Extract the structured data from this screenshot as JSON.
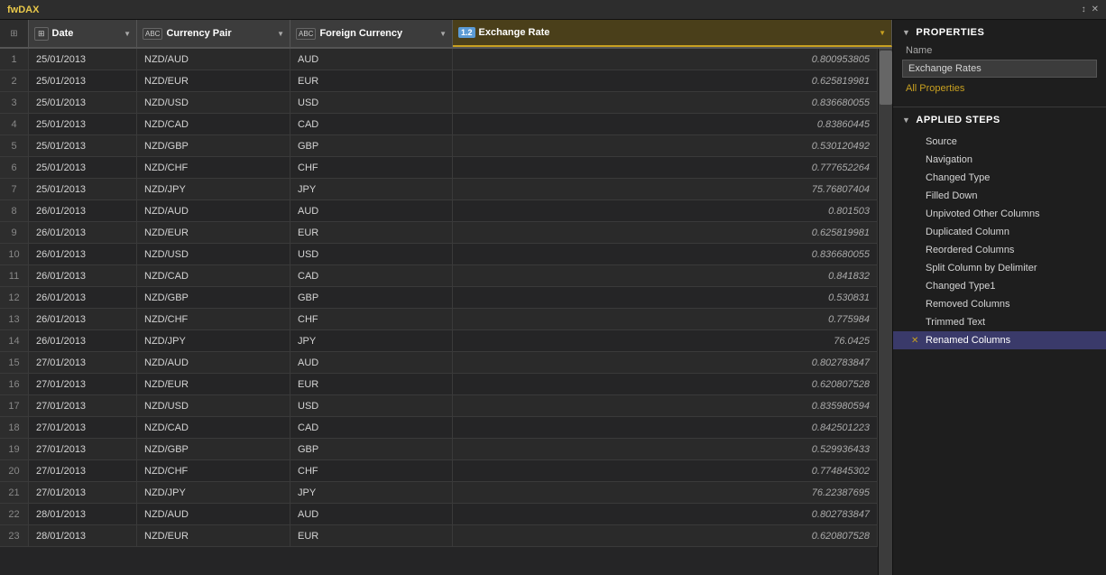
{
  "titlebar": {
    "logo": "fwDAX",
    "controls": [
      "↕",
      "×"
    ]
  },
  "table": {
    "columns": [
      {
        "id": "date",
        "label": "Date",
        "type": "date",
        "type_icon": "⊞",
        "has_dropdown": true
      },
      {
        "id": "currency_pair",
        "label": "Currency Pair",
        "type": "text",
        "type_icon": "ABC",
        "has_dropdown": true
      },
      {
        "id": "foreign_currency",
        "label": "Foreign Currency",
        "type": "text",
        "type_icon": "ABC",
        "has_dropdown": true
      },
      {
        "id": "exchange_rate",
        "label": "Exchange Rate",
        "type": "number",
        "type_icon": "1.2",
        "has_dropdown": true
      }
    ],
    "rows": [
      {
        "num": 1,
        "date": "25/01/2013",
        "pair": "NZD/AUD",
        "foreign": "AUD",
        "rate": "0.800953805"
      },
      {
        "num": 2,
        "date": "25/01/2013",
        "pair": "NZD/EUR",
        "foreign": "EUR",
        "rate": "0.625819981"
      },
      {
        "num": 3,
        "date": "25/01/2013",
        "pair": "NZD/USD",
        "foreign": "USD",
        "rate": "0.836680055"
      },
      {
        "num": 4,
        "date": "25/01/2013",
        "pair": "NZD/CAD",
        "foreign": "CAD",
        "rate": "0.83860445"
      },
      {
        "num": 5,
        "date": "25/01/2013",
        "pair": "NZD/GBP",
        "foreign": "GBP",
        "rate": "0.530120492"
      },
      {
        "num": 6,
        "date": "25/01/2013",
        "pair": "NZD/CHF",
        "foreign": "CHF",
        "rate": "0.777652264"
      },
      {
        "num": 7,
        "date": "25/01/2013",
        "pair": "NZD/JPY",
        "foreign": "JPY",
        "rate": "75.76807404"
      },
      {
        "num": 8,
        "date": "26/01/2013",
        "pair": "NZD/AUD",
        "foreign": "AUD",
        "rate": "0.801503"
      },
      {
        "num": 9,
        "date": "26/01/2013",
        "pair": "NZD/EUR",
        "foreign": "EUR",
        "rate": "0.625819981"
      },
      {
        "num": 10,
        "date": "26/01/2013",
        "pair": "NZD/USD",
        "foreign": "USD",
        "rate": "0.836680055"
      },
      {
        "num": 11,
        "date": "26/01/2013",
        "pair": "NZD/CAD",
        "foreign": "CAD",
        "rate": "0.841832"
      },
      {
        "num": 12,
        "date": "26/01/2013",
        "pair": "NZD/GBP",
        "foreign": "GBP",
        "rate": "0.530831"
      },
      {
        "num": 13,
        "date": "26/01/2013",
        "pair": "NZD/CHF",
        "foreign": "CHF",
        "rate": "0.775984"
      },
      {
        "num": 14,
        "date": "26/01/2013",
        "pair": "NZD/JPY",
        "foreign": "JPY",
        "rate": "76.0425"
      },
      {
        "num": 15,
        "date": "27/01/2013",
        "pair": "NZD/AUD",
        "foreign": "AUD",
        "rate": "0.802783847"
      },
      {
        "num": 16,
        "date": "27/01/2013",
        "pair": "NZD/EUR",
        "foreign": "EUR",
        "rate": "0.620807528"
      },
      {
        "num": 17,
        "date": "27/01/2013",
        "pair": "NZD/USD",
        "foreign": "USD",
        "rate": "0.835980594"
      },
      {
        "num": 18,
        "date": "27/01/2013",
        "pair": "NZD/CAD",
        "foreign": "CAD",
        "rate": "0.842501223"
      },
      {
        "num": 19,
        "date": "27/01/2013",
        "pair": "NZD/GBP",
        "foreign": "GBP",
        "rate": "0.529936433"
      },
      {
        "num": 20,
        "date": "27/01/2013",
        "pair": "NZD/CHF",
        "foreign": "CHF",
        "rate": "0.774845302"
      },
      {
        "num": 21,
        "date": "27/01/2013",
        "pair": "NZD/JPY",
        "foreign": "JPY",
        "rate": "76.22387695"
      },
      {
        "num": 22,
        "date": "28/01/2013",
        "pair": "NZD/AUD",
        "foreign": "AUD",
        "rate": "0.802783847"
      },
      {
        "num": 23,
        "date": "28/01/2013",
        "pair": "NZD/EUR",
        "foreign": "EUR",
        "rate": "0.620807528"
      }
    ]
  },
  "properties": {
    "header": "PROPERTIES",
    "name_label": "Name",
    "name_value": "Exchange Rates",
    "all_properties_label": "All Properties"
  },
  "applied_steps": {
    "header": "APPLIED STEPS",
    "steps": [
      {
        "id": "source",
        "label": "Source",
        "active": false,
        "error": false
      },
      {
        "id": "navigation",
        "label": "Navigation",
        "active": false,
        "error": false
      },
      {
        "id": "changed_type",
        "label": "Changed Type",
        "active": false,
        "error": false
      },
      {
        "id": "filled_down",
        "label": "Filled Down",
        "active": false,
        "error": false
      },
      {
        "id": "unpivoted",
        "label": "Unpivoted Other Columns",
        "active": false,
        "error": false
      },
      {
        "id": "duplicated_column",
        "label": "Duplicated Column",
        "active": false,
        "error": false
      },
      {
        "id": "reordered_columns",
        "label": "Reordered Columns",
        "active": false,
        "error": false
      },
      {
        "id": "split_column",
        "label": "Split Column by Delimiter",
        "active": false,
        "error": false
      },
      {
        "id": "changed_type1",
        "label": "Changed Type1",
        "active": false,
        "error": false
      },
      {
        "id": "removed_columns",
        "label": "Removed Columns",
        "active": false,
        "error": false
      },
      {
        "id": "trimmed_text",
        "label": "Trimmed Text",
        "active": false,
        "error": false
      },
      {
        "id": "renamed_columns",
        "label": "Renamed Columns",
        "active": true,
        "error": false
      }
    ]
  }
}
